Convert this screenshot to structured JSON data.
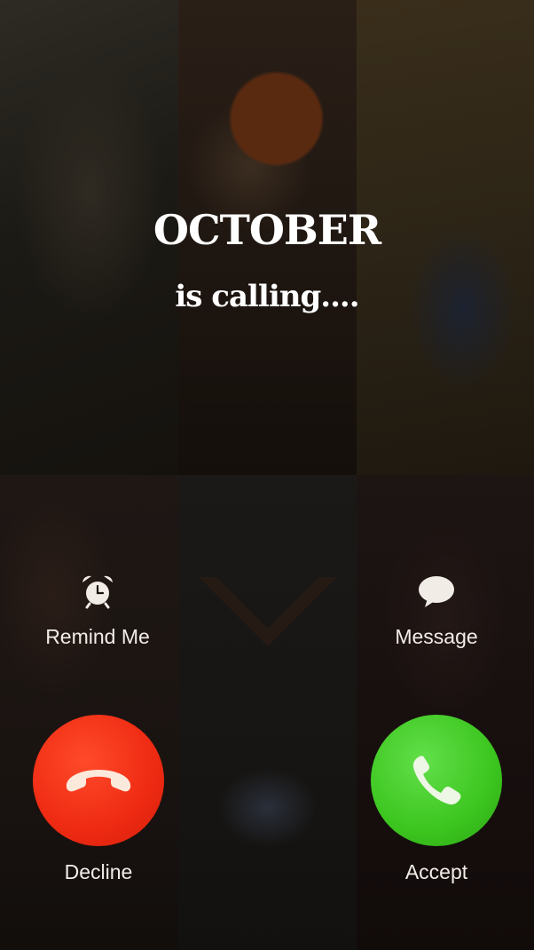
{
  "caller": {
    "name": "OCTOBER",
    "status": "is calling...."
  },
  "options": {
    "remind_label": "Remind Me",
    "remind_icon": "alarm-clock-icon",
    "message_label": "Message",
    "message_icon": "speech-bubble-icon"
  },
  "actions": {
    "decline_label": "Decline",
    "decline_icon": "phone-hangup-icon",
    "decline_color": "#ee2a12",
    "accept_label": "Accept",
    "accept_icon": "phone-icon",
    "accept_color": "#3cc51f"
  }
}
